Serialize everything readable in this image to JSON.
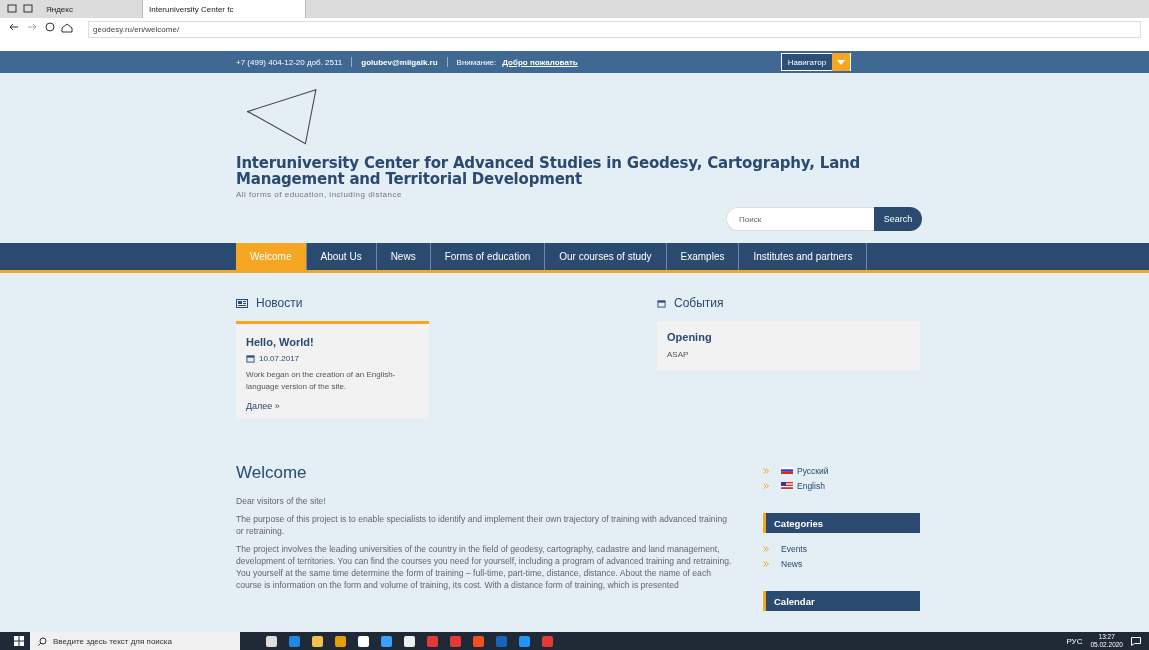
{
  "browser": {
    "tabs": [
      {
        "title": "Яндекс",
        "selected": false
      },
      {
        "title": "Interuniversity Center fc",
        "selected": true
      }
    ],
    "address": "geodesy.ru/en/welcome/"
  },
  "topbar": {
    "phone": "+7 (499) 404-12-20 доб. 2511",
    "email": "golubev@miigaik.ru",
    "notice_label": "Внимание:",
    "notice_link": "Добро пожаловать",
    "navigator": "Навигатор"
  },
  "header": {
    "title": "Interuniversity Center for Advanced Studies in Geodesy, Cartography, Land Management and Territorial Development",
    "subtitle": "All forms of education, including distance",
    "search": {
      "placeholder": "Поиск",
      "button": "Search"
    }
  },
  "nav": [
    {
      "label": "Welcome",
      "selected": true
    },
    {
      "label": "About Us",
      "selected": false
    },
    {
      "label": "News",
      "selected": false
    },
    {
      "label": "Forms of education",
      "selected": false
    },
    {
      "label": "Our courses of study",
      "selected": false
    },
    {
      "label": "Examples",
      "selected": false
    },
    {
      "label": "Institutes and partners",
      "selected": false
    }
  ],
  "news": {
    "heading": "Новости",
    "items": [
      {
        "title": "Hello, World!",
        "date": "10.07.2017",
        "text": "Work began on the creation of an English-language version of the site.",
        "more": "Далее »"
      }
    ]
  },
  "events": {
    "heading": "События",
    "items": [
      {
        "title": "Opening",
        "text": "ASAP"
      }
    ]
  },
  "article": {
    "heading": "Welcome",
    "paragraphs": [
      "Dear visitors of the site!",
      "The purpose of this project is to enable specialists to identify and implement their own trajectory of training with advanced training or retraining.",
      "The project involves the leading universities of the country in the field of geodesy, cartography, cadastre and land management, development of territories. You can find the courses you need for yourself, including a program of advanced training and retraining. You yourself at the same time determine the form of training – full-time, part-time, distance, distance. About the name of each course is information on the form and volume of training, its cost. With a distance form of training, which is presented"
    ]
  },
  "sidebar": {
    "languages": [
      {
        "label": "Русский",
        "kind": "ru"
      },
      {
        "label": "English",
        "kind": "us"
      }
    ],
    "categories": {
      "heading": "Categories",
      "items": [
        "Events",
        "News"
      ]
    },
    "calendar": {
      "heading": "Calendar"
    }
  },
  "taskbar": {
    "search_placeholder": "Введите здесь текст для поиска",
    "language": "РУС",
    "time": "13:27",
    "date": "05.02.2020"
  }
}
